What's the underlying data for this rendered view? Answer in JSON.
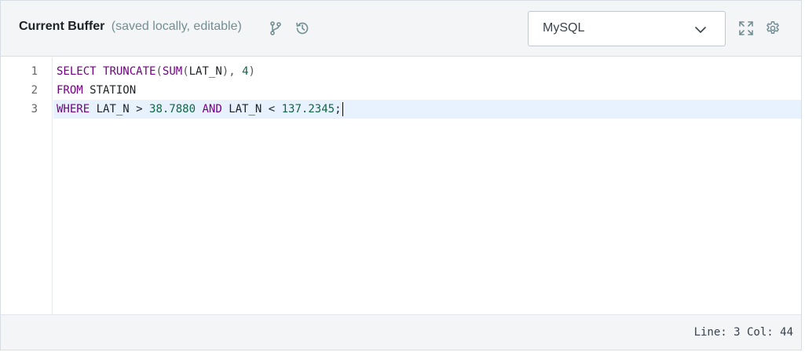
{
  "header": {
    "title": "Current Buffer",
    "subtitle": "(saved locally, editable)",
    "icons": [
      "branch-icon",
      "history-icon",
      "fullscreen-icon",
      "settings-icon"
    ]
  },
  "language_select": {
    "value": "MySQL"
  },
  "editor": {
    "line_numbers": [
      "1",
      "2",
      "3"
    ],
    "lines": [
      {
        "tokens": [
          {
            "t": "kw",
            "v": "SELECT"
          },
          {
            "t": "plain",
            "v": " "
          },
          {
            "t": "fn",
            "v": "TRUNCATE"
          },
          {
            "t": "punct",
            "v": "("
          },
          {
            "t": "fn",
            "v": "SUM"
          },
          {
            "t": "punct",
            "v": "("
          },
          {
            "t": "plain",
            "v": "LAT_N"
          },
          {
            "t": "punct",
            "v": "),"
          },
          {
            "t": "plain",
            "v": " "
          },
          {
            "t": "num",
            "v": "4"
          },
          {
            "t": "punct",
            "v": ")"
          }
        ]
      },
      {
        "tokens": [
          {
            "t": "kw",
            "v": "FROM"
          },
          {
            "t": "plain",
            "v": " STATION"
          }
        ]
      },
      {
        "tokens": [
          {
            "t": "kw",
            "v": "WHERE"
          },
          {
            "t": "plain",
            "v": " LAT_N > "
          },
          {
            "t": "num",
            "v": "38.7880"
          },
          {
            "t": "plain",
            "v": " "
          },
          {
            "t": "kw",
            "v": "AND"
          },
          {
            "t": "plain",
            "v": " LAT_N < "
          },
          {
            "t": "num",
            "v": "137.2345"
          },
          {
            "t": "plain",
            "v": ";"
          }
        ]
      }
    ],
    "active_line": 3
  },
  "status": {
    "text": "Line: 3 Col: 44"
  },
  "colors": {
    "keyword": "#770088",
    "number": "#116644",
    "active_line_bg": "#e8f2ff",
    "header_bg": "#f3f5f7"
  }
}
